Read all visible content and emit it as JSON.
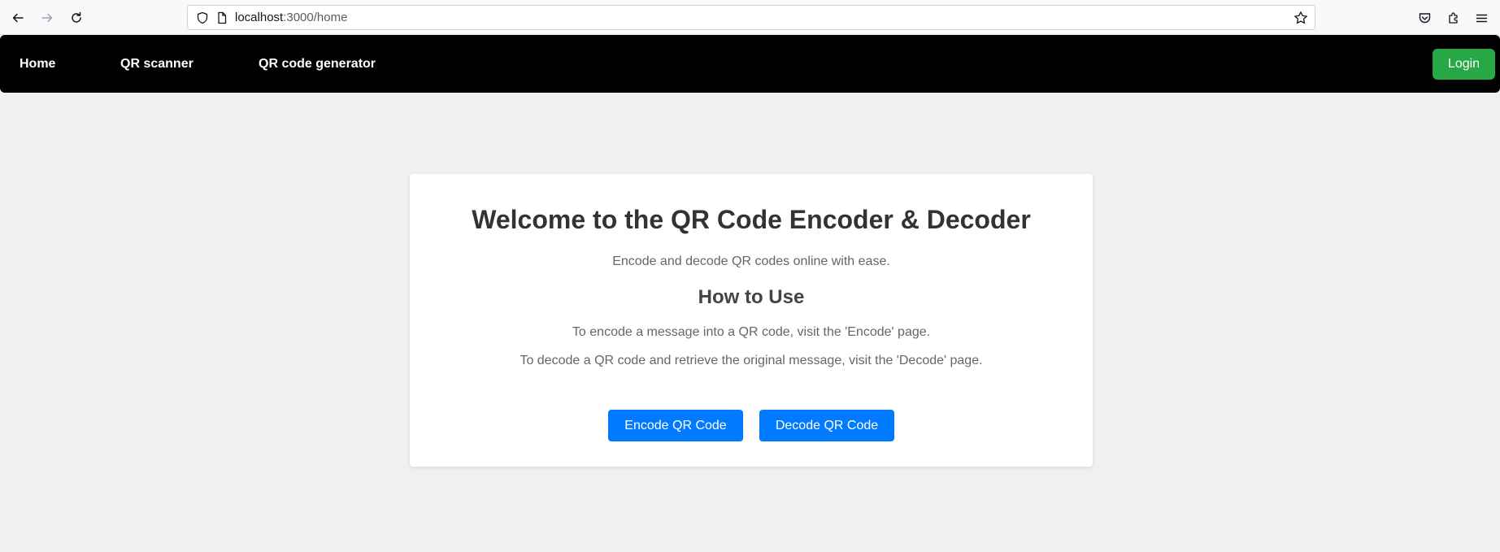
{
  "browser": {
    "url_host": "localhost",
    "url_path": ":3000/home"
  },
  "navbar": {
    "links": [
      {
        "label": "Home"
      },
      {
        "label": "QR scanner"
      },
      {
        "label": "QR code generator"
      }
    ],
    "login_label": "Login",
    "login_color": "#28a745"
  },
  "main": {
    "title": "Welcome to the QR Code Encoder & Decoder",
    "subtitle": "Encode and decode QR codes online with ease.",
    "how_to_heading": "How to Use",
    "instructions": [
      "To encode a message into a QR code, visit the 'Encode' page.",
      "To decode a QR code and retrieve the original message, visit the 'Decode' page."
    ],
    "encode_button": "Encode QR Code",
    "decode_button": "Decode QR Code",
    "button_color": "#007bff"
  },
  "icons": {
    "back": "arrow-left-icon",
    "forward": "arrow-right-icon",
    "reload": "reload-icon",
    "shield": "shield-icon",
    "page": "page-icon",
    "bookmark": "star-icon",
    "pocket": "pocket-icon",
    "extensions": "puzzle-icon",
    "menu": "hamburger-menu-icon"
  }
}
